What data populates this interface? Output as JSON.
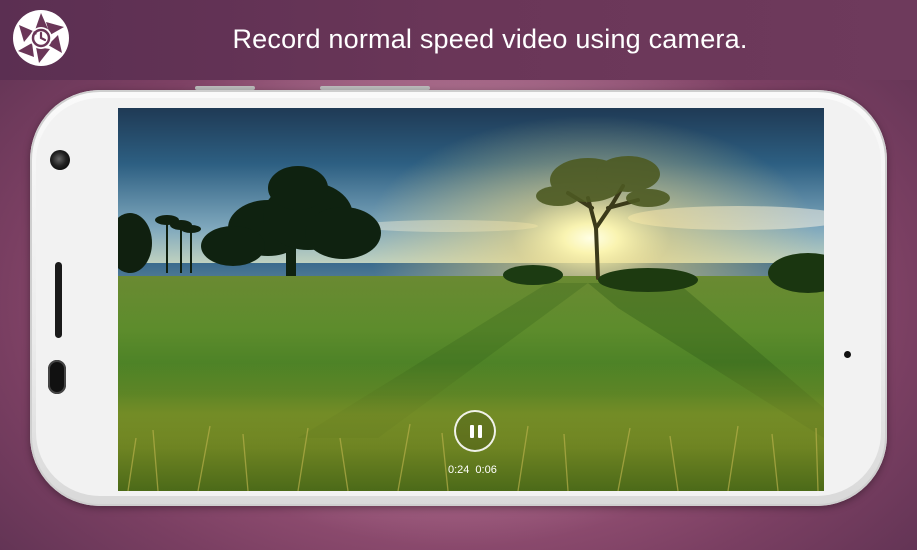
{
  "header": {
    "title": "Record normal speed video using camera.",
    "logo_icon": "camera-aperture-timer-icon"
  },
  "player": {
    "state": "playing",
    "control_icon": "pause-icon",
    "time_elapsed": "0:24",
    "time_remaining": "0:06"
  },
  "colors": {
    "header_bg": "#6a3658",
    "background": "#a45a7e",
    "phone_body": "#f2f2f2"
  }
}
